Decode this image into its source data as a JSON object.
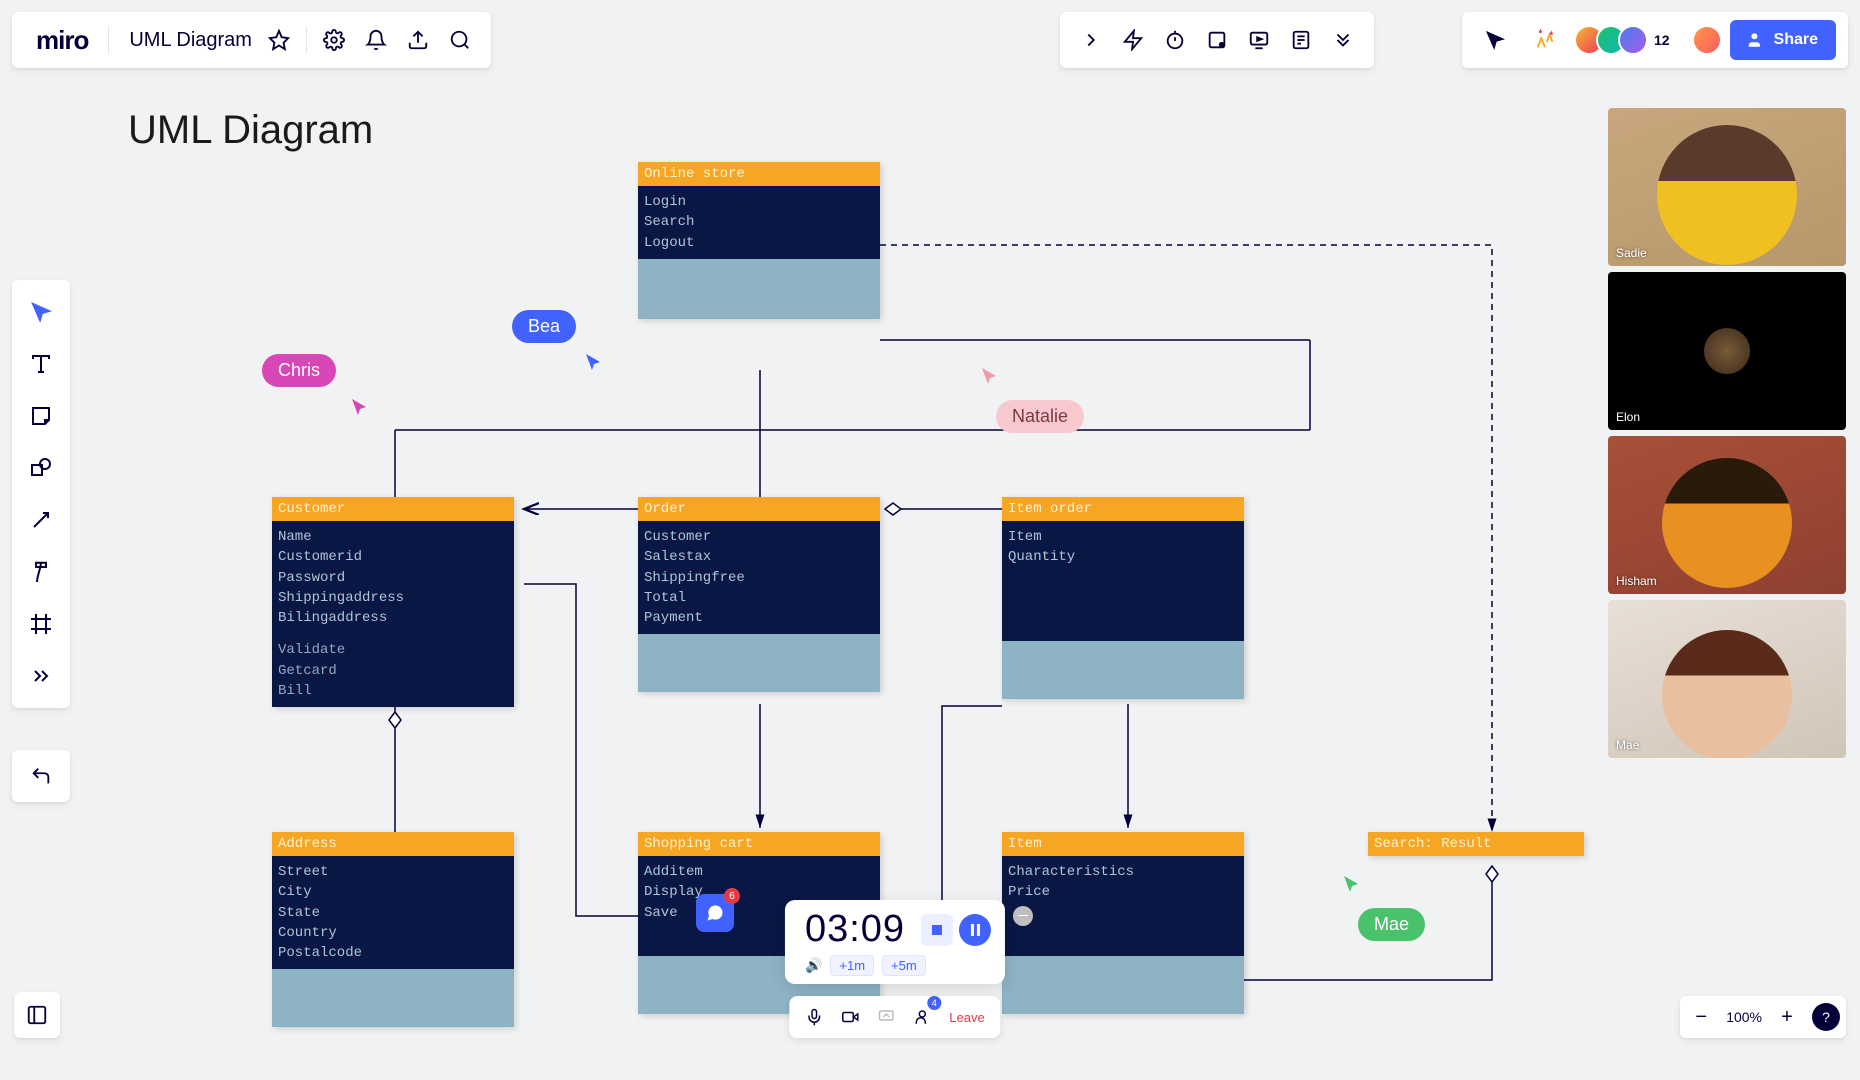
{
  "app": {
    "logo": "miro",
    "board_title": "UML Diagram"
  },
  "canvas": {
    "title": "UML Diagram"
  },
  "share": {
    "label": "Share"
  },
  "avatars": {
    "extra_count": "12"
  },
  "uml": {
    "online_store": {
      "title": "Online store",
      "attrs": [
        "Login",
        "Search",
        "Logout"
      ],
      "methods": []
    },
    "customer": {
      "title": "Customer",
      "attrs": [
        "Name",
        "Customerid",
        "Password",
        "Shippingaddress",
        "Bilingaddress"
      ],
      "methods": [
        "Validate",
        "Getcard",
        "Bill"
      ]
    },
    "order": {
      "title": "Order",
      "attrs": [
        "Customer",
        "Salestax",
        "Shippingfree",
        "Total",
        "Payment"
      ],
      "methods": []
    },
    "item_order": {
      "title": "Item order",
      "attrs": [
        "Item",
        "Quantity"
      ],
      "methods": []
    },
    "address": {
      "title": "Address",
      "attrs": [
        "Street",
        "City",
        "State",
        "Country",
        "Postalcode"
      ],
      "methods": []
    },
    "shopping_cart": {
      "title": "Shopping cart",
      "attrs": [
        "Additem",
        "Display",
        "Save"
      ],
      "methods": []
    },
    "item": {
      "title": "Item",
      "attrs": [
        "Characteristics",
        "Price"
      ],
      "methods": []
    },
    "search_result": {
      "title": "Search: Result",
      "attrs": [],
      "methods": []
    }
  },
  "cursors": {
    "chris": "Chris",
    "bea": "Bea",
    "natalie": "Natalie",
    "mae": "Mae"
  },
  "videos": {
    "v1": "Sadie",
    "v2": "Elon",
    "v3": "Hisham",
    "v4": "Mae"
  },
  "timer": {
    "time": "03:09",
    "add1": "+1m",
    "add5": "+5m"
  },
  "chat_count": "6",
  "call": {
    "people_count": "4",
    "leave": "Leave"
  },
  "zoom": {
    "value": "100%"
  },
  "help": "?"
}
